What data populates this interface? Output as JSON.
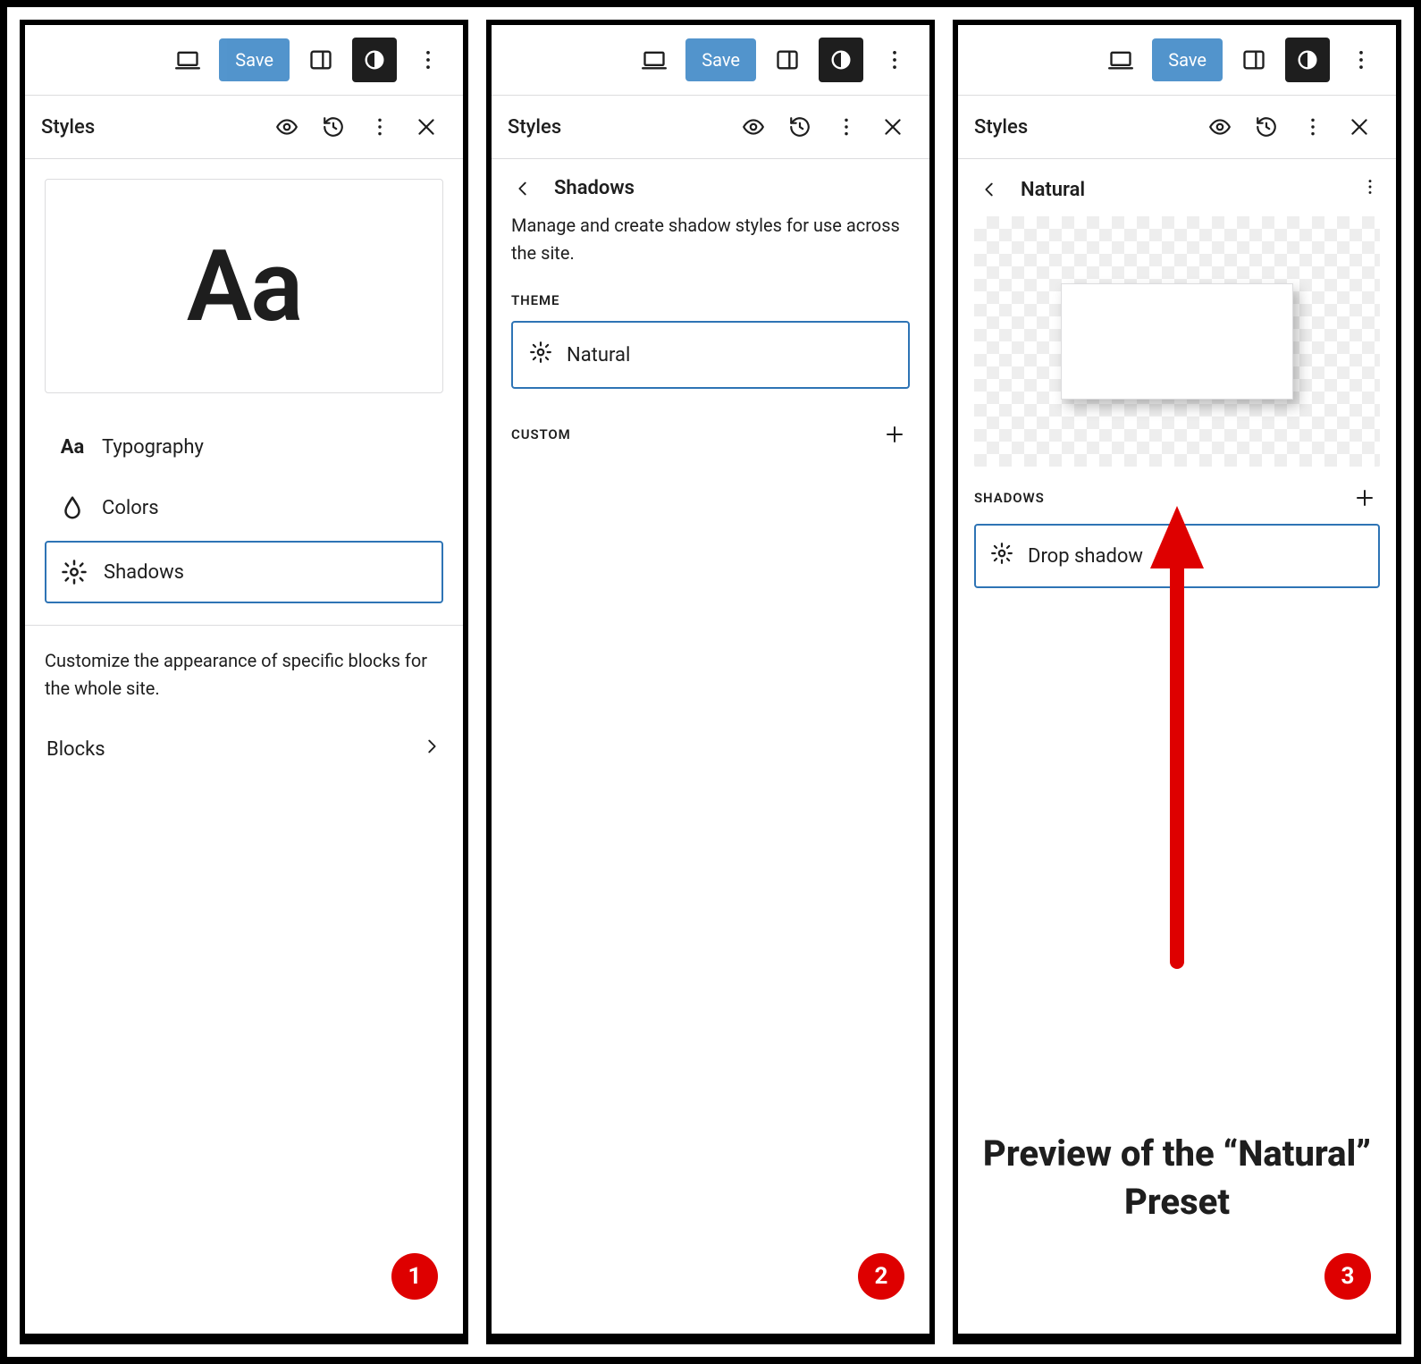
{
  "toolbar": {
    "save_label": "Save"
  },
  "styles_header": {
    "title": "Styles"
  },
  "panel1": {
    "preview_aa": "Aa",
    "typography": "Typography",
    "colors": "Colors",
    "shadows": "Shadows",
    "customize_desc": "Customize the appearance of specific blocks for the whole site.",
    "blocks": "Blocks"
  },
  "panel2": {
    "title": "Shadows",
    "description": "Manage and create shadow styles for use across the site.",
    "theme_label": "THEME",
    "theme_preset": "Natural",
    "custom_label": "CUSTOM"
  },
  "panel3": {
    "title": "Natural",
    "shadows_label": "SHADOWS",
    "drop_shadow": "Drop shadow",
    "annotation": "Preview of the “Natural” Preset"
  },
  "badges": {
    "p1": "1",
    "p2": "2",
    "p3": "3"
  }
}
